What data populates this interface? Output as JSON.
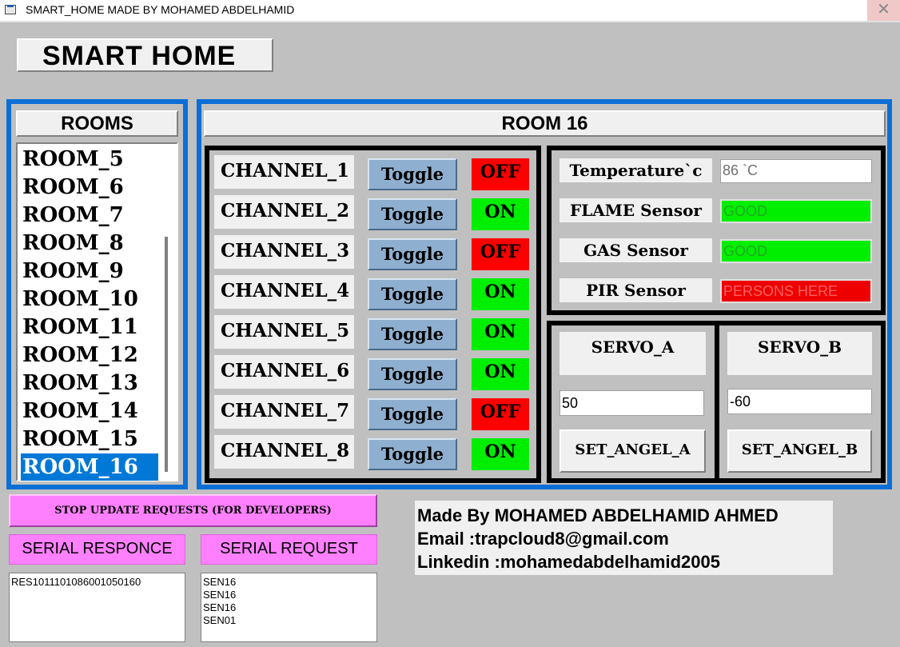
{
  "window": {
    "title": "SMART_HOME MADE BY MOHAMED ABDELHAMID",
    "close_glyph": "✕"
  },
  "app_title": "SMART HOME",
  "rooms": {
    "heading": "ROOMS",
    "items": [
      "ROOM_5",
      "ROOM_6",
      "ROOM_7",
      "ROOM_8",
      "ROOM_9",
      "ROOM_10",
      "ROOM_11",
      "ROOM_12",
      "ROOM_13",
      "ROOM_14",
      "ROOM_15",
      "ROOM_16"
    ],
    "selected": "ROOM_16"
  },
  "room_panel": {
    "heading": "ROOM 16"
  },
  "channels": [
    {
      "label": "CHANNEL_1",
      "button": "Toggle",
      "state": "OFF"
    },
    {
      "label": "CHANNEL_2",
      "button": "Toggle",
      "state": "ON"
    },
    {
      "label": "CHANNEL_3",
      "button": "Toggle",
      "state": "OFF"
    },
    {
      "label": "CHANNEL_4",
      "button": "Toggle",
      "state": "ON"
    },
    {
      "label": "CHANNEL_5",
      "button": "Toggle",
      "state": "ON"
    },
    {
      "label": "CHANNEL_6",
      "button": "Toggle",
      "state": "ON"
    },
    {
      "label": "CHANNEL_7",
      "button": "Toggle",
      "state": "OFF"
    },
    {
      "label": "CHANNEL_8",
      "button": "Toggle",
      "state": "ON"
    }
  ],
  "sensors": [
    {
      "label": "Temperature`c",
      "value": "86 `C",
      "status": "neutral"
    },
    {
      "label": "FLAME Sensor",
      "value": "GOOD",
      "status": "good"
    },
    {
      "label": "GAS Sensor",
      "value": "GOOD",
      "status": "good"
    },
    {
      "label": "PIR Sensor",
      "value": "PERSONS HERE",
      "status": "alert"
    }
  ],
  "servos": {
    "a": {
      "label": "SERVO_A",
      "value": "50",
      "button": "SET_ANGEL_A"
    },
    "b": {
      "label": "SERVO_B",
      "value": "-60",
      "button": "SET_ANGEL_B"
    }
  },
  "developer": {
    "stop_button": "STOP UPDATE REQUESTS (FOR DEVELOPERS)",
    "serial_response_label": "SERIAL RESPONCE",
    "serial_request_label": "SERIAL REQUEST",
    "serial_response_text": "RES1011101086001050160",
    "serial_request_text": "SEN16\nSEN16\nSEN16\nSEN01"
  },
  "credits": {
    "made_by": "Made By MOHAMED ABDELHAMID AHMED",
    "email": "Email :trapcloud8@gmail.com",
    "linkedin": "Linkedin :mohamedabdelhamid2005"
  },
  "colors": {
    "panel_border": "#0b6fd6",
    "on": "#00ee00",
    "off": "#ff0000",
    "good_bg": "#00ee00",
    "good_text": "#22aa22",
    "alert_bg": "#ee0000",
    "alert_text": "#ff6060",
    "selection": "#0078d7",
    "developer_pink": "#ff80ff"
  }
}
